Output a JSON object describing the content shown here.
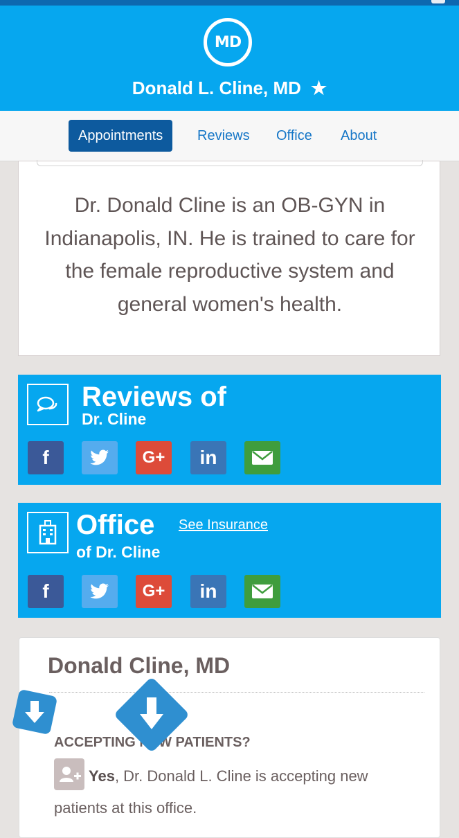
{
  "header": {
    "logo_text": "MD",
    "doctor_name": "Donald L. Cline, MD",
    "favorite_icon": "star-icon"
  },
  "nav": {
    "tabs": [
      {
        "label": "Appointments",
        "active": true
      },
      {
        "label": "Reviews",
        "active": false
      },
      {
        "label": "Office",
        "active": false
      },
      {
        "label": "About",
        "active": false
      }
    ]
  },
  "about": {
    "description": "Dr. Donald Cline is an OB-GYN in Indianapolis, IN. He is trained to care for the female reproductive system and general women's health."
  },
  "reviews_section": {
    "title": "Reviews of",
    "subtitle": "Dr. Cline",
    "icon": "chat-bubbles-icon"
  },
  "office_section": {
    "title": "Office",
    "subtitle": "of Dr. Cline",
    "see_insurance": "See Insurance",
    "icon": "hospital-building-icon"
  },
  "share_buttons": [
    {
      "name": "facebook",
      "glyph": "f",
      "color": "#3b5998"
    },
    {
      "name": "twitter",
      "glyph": "twitter-bird",
      "color": "#55acee"
    },
    {
      "name": "google-plus",
      "glyph": "G+",
      "color": "#dd4b39"
    },
    {
      "name": "linkedin",
      "glyph": "in",
      "color": "#3a75b6"
    },
    {
      "name": "email",
      "glyph": "envelope",
      "color": "#3f9d3d"
    }
  ],
  "office_card": {
    "name": "Donald Cline, MD",
    "accepting_label": "ACCEPTING NEW PATIENTS?",
    "answer": "Yes",
    "answer_text": ", Dr. Donald L. Cline is accepting new patients at this office."
  },
  "colors": {
    "brand_blue": "#06a7ef",
    "nav_active": "#0d5a9e",
    "link_blue": "#1777c7",
    "text_gray": "#5f5555",
    "overlay_arrow": "#2f8fd0"
  }
}
